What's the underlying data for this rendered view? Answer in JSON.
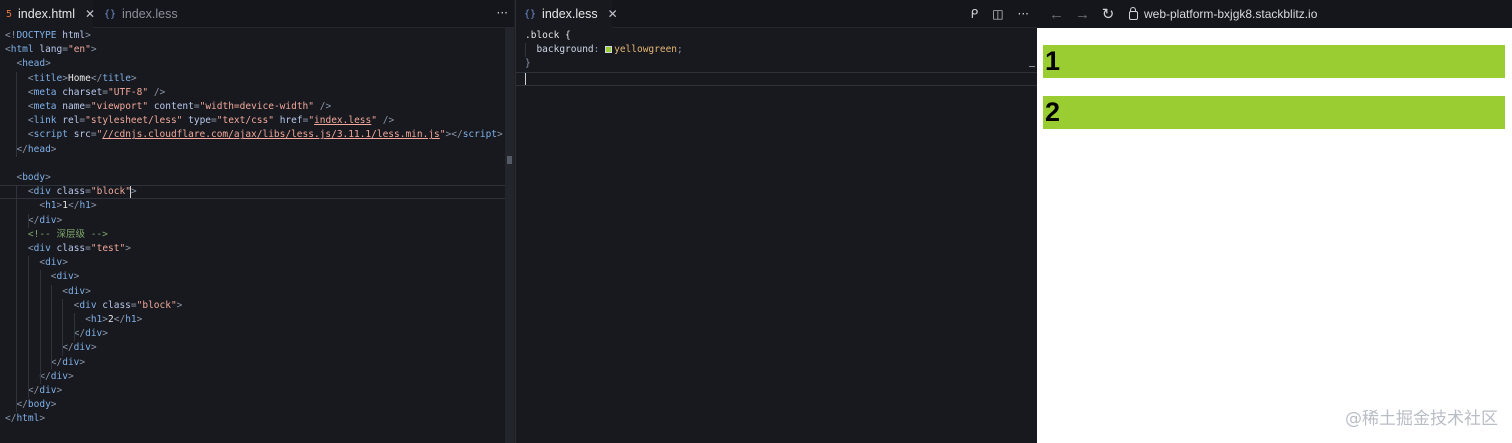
{
  "left_editor": {
    "tabs": [
      {
        "icon": "5",
        "label": "index.html",
        "close": "✕",
        "active": true
      },
      {
        "icon": "{}",
        "label": "index.less",
        "active": false
      }
    ],
    "more": "···",
    "lines": [
      [
        [
          "punc",
          "<!"
        ],
        [
          "tag",
          "DOCTYPE"
        ],
        [
          "text",
          " "
        ],
        [
          "attr",
          "html"
        ],
        [
          "punc",
          ">"
        ]
      ],
      [
        [
          "punc",
          "<"
        ],
        [
          "tag",
          "html"
        ],
        [
          "text",
          " "
        ],
        [
          "attr",
          "lang"
        ],
        [
          "punc",
          "="
        ],
        [
          "str",
          "\"en\""
        ],
        [
          "punc",
          ">"
        ]
      ],
      [
        [
          "text",
          "  "
        ],
        [
          "punc",
          "<"
        ],
        [
          "tag",
          "head"
        ],
        [
          "punc",
          ">"
        ]
      ],
      [
        [
          "text",
          "    "
        ],
        [
          "punc",
          "<"
        ],
        [
          "tag",
          "title"
        ],
        [
          "punc",
          ">"
        ],
        [
          "text",
          "Home"
        ],
        [
          "punc",
          "</"
        ],
        [
          "tag",
          "title"
        ],
        [
          "punc",
          ">"
        ]
      ],
      [
        [
          "text",
          "    "
        ],
        [
          "punc",
          "<"
        ],
        [
          "tag",
          "meta"
        ],
        [
          "text",
          " "
        ],
        [
          "attr",
          "charset"
        ],
        [
          "punc",
          "="
        ],
        [
          "str",
          "\"UTF-8\""
        ],
        [
          "text",
          " "
        ],
        [
          "punc",
          "/>"
        ]
      ],
      [
        [
          "text",
          "    "
        ],
        [
          "punc",
          "<"
        ],
        [
          "tag",
          "meta"
        ],
        [
          "text",
          " "
        ],
        [
          "attr",
          "name"
        ],
        [
          "punc",
          "="
        ],
        [
          "str",
          "\"viewport\""
        ],
        [
          "text",
          " "
        ],
        [
          "attr",
          "content"
        ],
        [
          "punc",
          "="
        ],
        [
          "str",
          "\"width=device-width\""
        ],
        [
          "text",
          " "
        ],
        [
          "punc",
          "/>"
        ]
      ],
      [
        [
          "text",
          "    "
        ],
        [
          "punc",
          "<"
        ],
        [
          "tag",
          "link"
        ],
        [
          "text",
          " "
        ],
        [
          "attr",
          "rel"
        ],
        [
          "punc",
          "="
        ],
        [
          "str",
          "\"stylesheet/less\""
        ],
        [
          "text",
          " "
        ],
        [
          "attr",
          "type"
        ],
        [
          "punc",
          "="
        ],
        [
          "str",
          "\"text/css\""
        ],
        [
          "text",
          " "
        ],
        [
          "attr",
          "href"
        ],
        [
          "punc",
          "="
        ],
        [
          "str",
          "\""
        ],
        [
          "link",
          "index.less"
        ],
        [
          "str",
          "\""
        ],
        [
          "text",
          " "
        ],
        [
          "punc",
          "/>"
        ]
      ],
      [
        [
          "text",
          "    "
        ],
        [
          "punc",
          "<"
        ],
        [
          "tag",
          "script"
        ],
        [
          "text",
          " "
        ],
        [
          "attr",
          "src"
        ],
        [
          "punc",
          "="
        ],
        [
          "str",
          "\""
        ],
        [
          "link",
          "//cdnjs.cloudflare.com/ajax/libs/less.js/3.11.1/less.min.js"
        ],
        [
          "str",
          "\""
        ],
        [
          "punc",
          "></"
        ],
        [
          "tag",
          "script"
        ],
        [
          "punc",
          ">"
        ]
      ],
      [
        [
          "text",
          "  "
        ],
        [
          "punc",
          "</"
        ],
        [
          "tag",
          "head"
        ],
        [
          "punc",
          ">"
        ]
      ],
      [],
      [
        [
          "text",
          "  "
        ],
        [
          "punc",
          "<"
        ],
        [
          "tag",
          "body"
        ],
        [
          "punc",
          ">"
        ]
      ],
      [
        [
          "text",
          "    "
        ],
        [
          "punc",
          "<"
        ],
        [
          "tag",
          "div"
        ],
        [
          "text",
          " "
        ],
        [
          "attr",
          "class"
        ],
        [
          "punc",
          "="
        ],
        [
          "str",
          "\"block\""
        ],
        [
          "punc",
          ">"
        ]
      ],
      [
        [
          "text",
          "      "
        ],
        [
          "punc",
          "<"
        ],
        [
          "tag",
          "h1"
        ],
        [
          "punc",
          ">"
        ],
        [
          "text",
          "1"
        ],
        [
          "punc",
          "</"
        ],
        [
          "tag",
          "h1"
        ],
        [
          "punc",
          ">"
        ]
      ],
      [
        [
          "text",
          "    "
        ],
        [
          "punc",
          "</"
        ],
        [
          "tag",
          "div"
        ],
        [
          "punc",
          ">"
        ]
      ],
      [
        [
          "text",
          "    "
        ],
        [
          "com",
          "<!-- 深层级 -->"
        ]
      ],
      [
        [
          "text",
          "    "
        ],
        [
          "punc",
          "<"
        ],
        [
          "tag",
          "div"
        ],
        [
          "text",
          " "
        ],
        [
          "attr",
          "class"
        ],
        [
          "punc",
          "="
        ],
        [
          "str",
          "\"test\""
        ],
        [
          "punc",
          ">"
        ]
      ],
      [
        [
          "text",
          "      "
        ],
        [
          "punc",
          "<"
        ],
        [
          "tag",
          "div"
        ],
        [
          "punc",
          ">"
        ]
      ],
      [
        [
          "text",
          "        "
        ],
        [
          "punc",
          "<"
        ],
        [
          "tag",
          "div"
        ],
        [
          "punc",
          ">"
        ]
      ],
      [
        [
          "text",
          "          "
        ],
        [
          "punc",
          "<"
        ],
        [
          "tag",
          "div"
        ],
        [
          "punc",
          ">"
        ]
      ],
      [
        [
          "text",
          "            "
        ],
        [
          "punc",
          "<"
        ],
        [
          "tag",
          "div"
        ],
        [
          "text",
          " "
        ],
        [
          "attr",
          "class"
        ],
        [
          "punc",
          "="
        ],
        [
          "str",
          "\"block\""
        ],
        [
          "punc",
          ">"
        ]
      ],
      [
        [
          "text",
          "              "
        ],
        [
          "punc",
          "<"
        ],
        [
          "tag",
          "h1"
        ],
        [
          "punc",
          ">"
        ],
        [
          "text",
          "2"
        ],
        [
          "punc",
          "</"
        ],
        [
          "tag",
          "h1"
        ],
        [
          "punc",
          ">"
        ]
      ],
      [
        [
          "text",
          "            "
        ],
        [
          "punc",
          "</"
        ],
        [
          "tag",
          "div"
        ],
        [
          "punc",
          ">"
        ]
      ],
      [
        [
          "text",
          "          "
        ],
        [
          "punc",
          "</"
        ],
        [
          "tag",
          "div"
        ],
        [
          "punc",
          ">"
        ]
      ],
      [
        [
          "text",
          "        "
        ],
        [
          "punc",
          "</"
        ],
        [
          "tag",
          "div"
        ],
        [
          "punc",
          ">"
        ]
      ],
      [
        [
          "text",
          "      "
        ],
        [
          "punc",
          "</"
        ],
        [
          "tag",
          "div"
        ],
        [
          "punc",
          ">"
        ]
      ],
      [
        [
          "text",
          "    "
        ],
        [
          "punc",
          "</"
        ],
        [
          "tag",
          "div"
        ],
        [
          "punc",
          ">"
        ]
      ],
      [
        [
          "text",
          "  "
        ],
        [
          "punc",
          "</"
        ],
        [
          "tag",
          "body"
        ],
        [
          "punc",
          ">"
        ]
      ],
      [
        [
          "punc",
          "</"
        ],
        [
          "tag",
          "html"
        ],
        [
          "punc",
          ">"
        ]
      ]
    ]
  },
  "mid_editor": {
    "tab": {
      "icon": "{}",
      "label": "index.less",
      "close": "✕"
    },
    "actions": [
      "ᑭ",
      "◫",
      "···"
    ],
    "lines": [
      [
        [
          "sel",
          ".block {"
        ]
      ],
      [
        [
          "text",
          "  "
        ],
        [
          "prop",
          "background"
        ],
        [
          "punc",
          ": "
        ],
        [
          "swatch",
          ""
        ],
        [
          "val",
          "yellowgreen"
        ],
        [
          "punc",
          ";"
        ]
      ],
      [
        [
          "punc",
          "}"
        ]
      ],
      []
    ]
  },
  "browser": {
    "back": "←",
    "forward": "→",
    "reload": "↻",
    "url": "web-platform-bxjgk8.stackblitz.io",
    "blocks": [
      "1",
      "2"
    ],
    "block_color": "#9acd32"
  },
  "watermark": "@稀土掘金技术社区"
}
